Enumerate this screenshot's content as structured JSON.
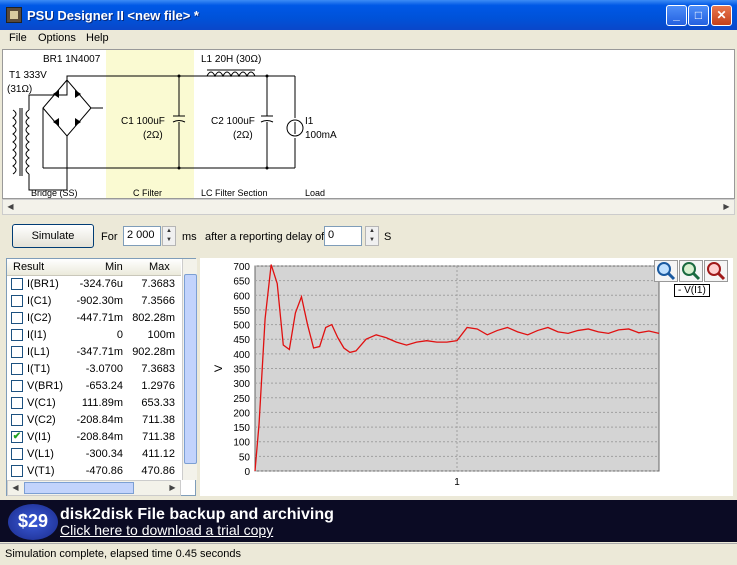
{
  "window": {
    "title": "PSU Designer II  <new file> *",
    "minimize": "_",
    "maximize": "□",
    "close": "✕"
  },
  "menu": [
    "File",
    "Options",
    "Help"
  ],
  "circuit": {
    "transformer": "T1 333V",
    "transformer_res": "(31Ω)",
    "rectifier": "BR1 1N4007",
    "cap1": "C1 100uF",
    "cap1_res": "(2Ω)",
    "inductor": "L1 20H (30Ω)",
    "cap2": "C2 100uF",
    "cap2_res": "(2Ω)",
    "load": "I1",
    "load_value": "100mA",
    "captions": {
      "bridge": "Bridge (SS)",
      "cfilter": "C Filter",
      "lcfilter": "LC Filter Section",
      "load": "Load"
    }
  },
  "simulate": {
    "button": "Simulate",
    "for_label": "For",
    "duration": "2 000",
    "duration_unit": "ms",
    "delay_label": "after a reporting delay of",
    "delay": "0",
    "delay_unit": "S"
  },
  "results": {
    "headers": [
      "Result",
      "Min",
      "Max"
    ],
    "rows": [
      {
        "name": "I(BR1)",
        "min": "-324.76u",
        "max": "7.3683",
        "checked": false
      },
      {
        "name": "I(C1)",
        "min": "-902.30m",
        "max": "7.3566",
        "checked": false
      },
      {
        "name": "I(C2)",
        "min": "-447.71m",
        "max": "802.28m",
        "checked": false
      },
      {
        "name": "I(I1)",
        "min": "0",
        "max": "100m",
        "checked": false
      },
      {
        "name": "I(L1)",
        "min": "-347.71m",
        "max": "902.28m",
        "checked": false
      },
      {
        "name": "I(T1)",
        "min": "-3.0700",
        "max": "7.3683",
        "checked": false
      },
      {
        "name": "V(BR1)",
        "min": "-653.24",
        "max": "1.2976",
        "checked": false
      },
      {
        "name": "V(C1)",
        "min": "111.89m",
        "max": "653.33",
        "checked": false
      },
      {
        "name": "V(C2)",
        "min": "-208.84m",
        "max": "711.38",
        "checked": false
      },
      {
        "name": "V(I1)",
        "min": "-208.84m",
        "max": "711.38",
        "checked": true
      },
      {
        "name": "V(L1)",
        "min": "-300.34",
        "max": "411.12",
        "checked": false
      },
      {
        "name": "V(T1)",
        "min": "-470.86",
        "max": "470.86",
        "checked": false
      }
    ]
  },
  "chart_data": {
    "type": "line",
    "ylabel": "V",
    "xlabel": "",
    "ylim": [
      0,
      700
    ],
    "xlim": [
      0,
      2
    ],
    "yticks": [
      0,
      50,
      100,
      150,
      200,
      250,
      300,
      350,
      400,
      450,
      500,
      550,
      600,
      650,
      700
    ],
    "xticks": [
      1
    ],
    "grid": true,
    "legend": "- V(I1)",
    "series": [
      {
        "name": "V(I1)",
        "color": "#e01010",
        "x": [
          0,
          0.02,
          0.05,
          0.08,
          0.11,
          0.14,
          0.17,
          0.2,
          0.23,
          0.26,
          0.29,
          0.32,
          0.35,
          0.38,
          0.41,
          0.44,
          0.47,
          0.5,
          0.55,
          0.6,
          0.65,
          0.7,
          0.75,
          0.8,
          0.85,
          0.9,
          0.95,
          1.0,
          1.05,
          1.1,
          1.15,
          1.2,
          1.25,
          1.3,
          1.35,
          1.4,
          1.45,
          1.5,
          1.55,
          1.6,
          1.65,
          1.7,
          1.75,
          1.8,
          1.85,
          1.9,
          1.95,
          2.0
        ],
        "values": [
          0,
          160,
          520,
          705,
          640,
          430,
          415,
          540,
          595,
          500,
          420,
          425,
          490,
          500,
          455,
          420,
          405,
          410,
          450,
          465,
          455,
          440,
          430,
          440,
          445,
          440,
          440,
          445,
          490,
          485,
          465,
          480,
          490,
          475,
          465,
          480,
          490,
          475,
          470,
          480,
          485,
          475,
          470,
          482,
          485,
          472,
          478,
          470
        ]
      }
    ]
  },
  "ad": {
    "price": "$29",
    "headline": "disk2disk File backup and archiving",
    "link": "Click here to download a trial copy"
  },
  "status": "Simulation complete, elapsed time 0.45 seconds"
}
